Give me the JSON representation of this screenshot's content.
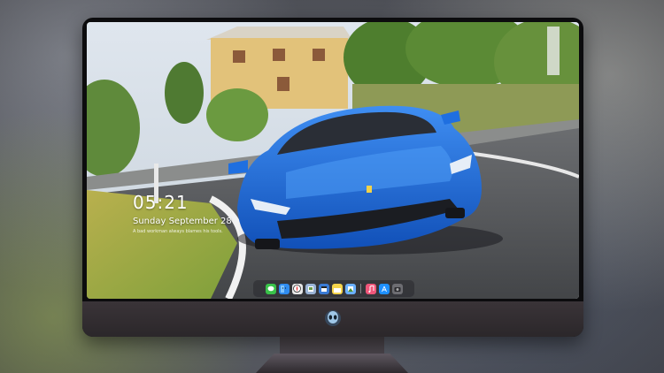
{
  "lock_screen": {
    "time": "05:21",
    "date": "Sunday September 28",
    "quote": "A bad workman always blames his tools."
  },
  "dock": {
    "apps": [
      {
        "name": "messages-icon",
        "color": "#3ac24a"
      },
      {
        "name": "finder-icon",
        "color": "#2f8cf0"
      },
      {
        "name": "safari-icon",
        "color": "#e8e8e8"
      },
      {
        "name": "preview-icon",
        "color": "#9ab4d6"
      },
      {
        "name": "claquette-icon",
        "color": "#3a7bd5"
      },
      {
        "name": "notes-icon",
        "color": "#f5d44b"
      },
      {
        "name": "photos-icon",
        "color": "#6ab0ff"
      },
      {
        "name": "music-icon",
        "color": "#f0567a"
      },
      {
        "name": "app-store-icon",
        "color": "#1e90ff"
      },
      {
        "name": "camera-icon",
        "color": "#6d6d72"
      }
    ]
  },
  "colors": {
    "car": "#1f6fe0",
    "monitor_chin": "#2b272a"
  }
}
